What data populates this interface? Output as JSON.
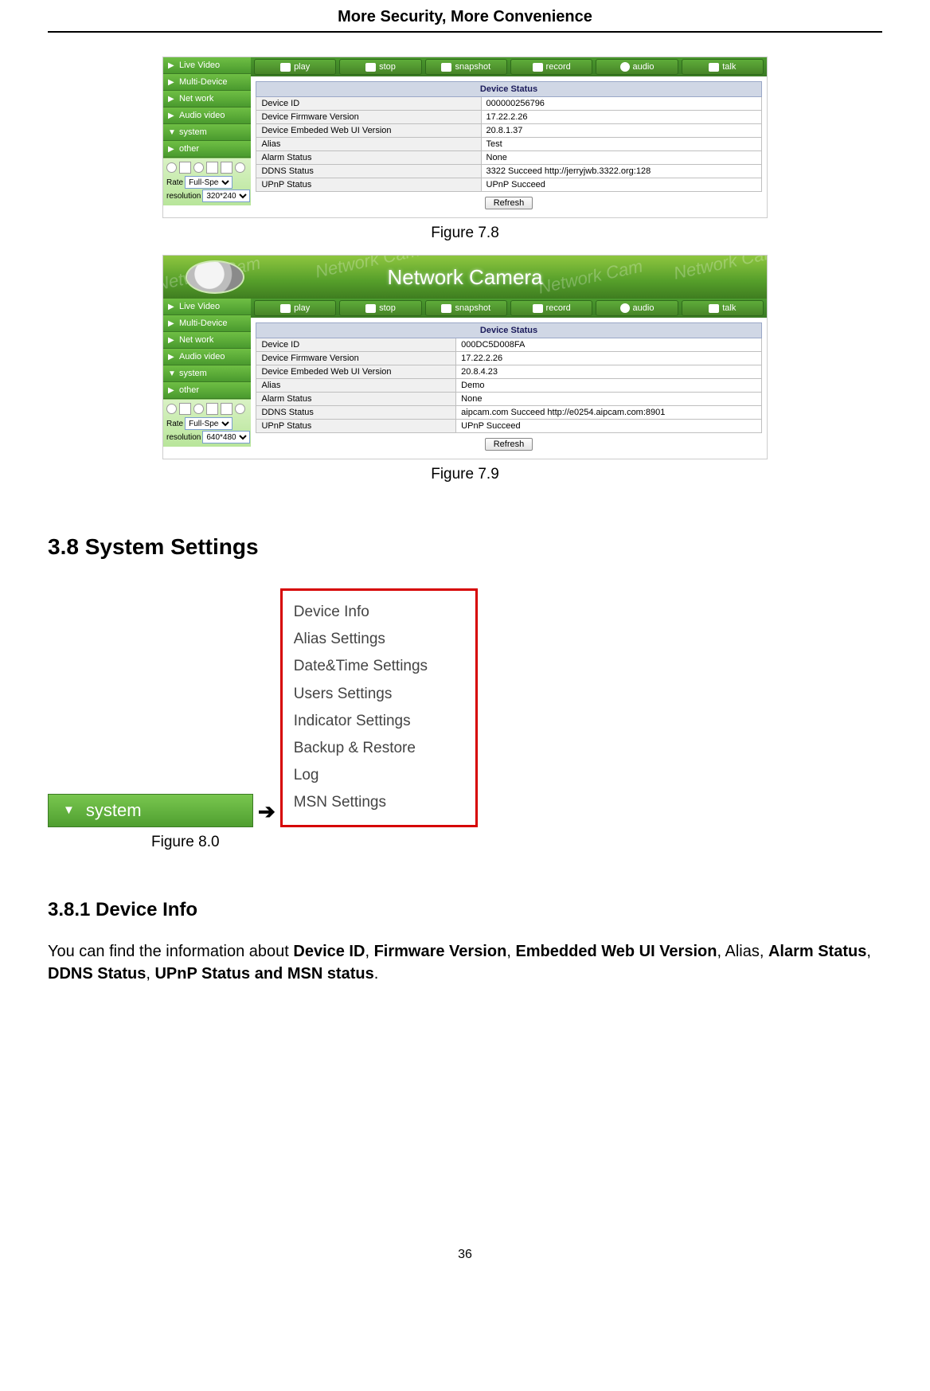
{
  "header": {
    "title": "More Security, More Convenience"
  },
  "fig78": {
    "sidebar": {
      "items": [
        {
          "label": "Live Video",
          "arrow": "▶"
        },
        {
          "label": "Multi-Device",
          "arrow": "▶"
        },
        {
          "label": "Net work",
          "arrow": "▶"
        },
        {
          "label": "Audio video",
          "arrow": "▶"
        },
        {
          "label": "system",
          "arrow": "▼"
        },
        {
          "label": "other",
          "arrow": "▶"
        }
      ],
      "rate_label": "Rate",
      "rate_value": "Full-Speed",
      "resolution_label": "resolution",
      "resolution_value": "320*240"
    },
    "toolbar": {
      "play": "play",
      "stop": "stop",
      "snapshot": "snapshot",
      "record": "record",
      "audio": "audio",
      "talk": "talk"
    },
    "status": {
      "title": "Device Status",
      "rows": [
        {
          "k": "Device ID",
          "v": "000000256796"
        },
        {
          "k": "Device Firmware Version",
          "v": "17.22.2.26"
        },
        {
          "k": "Device Embeded Web UI Version",
          "v": "20.8.1.37"
        },
        {
          "k": "Alias",
          "v": "Test"
        },
        {
          "k": "Alarm Status",
          "v": "None"
        },
        {
          "k": "DDNS Status",
          "v": "3322 Succeed  http://jerryjwb.3322.org:128"
        },
        {
          "k": "UPnP Status",
          "v": "UPnP Succeed"
        }
      ],
      "refresh": "Refresh"
    },
    "caption": "Figure 7.8"
  },
  "fig79": {
    "banner": {
      "title": "Network Camera",
      "watermark": "Network Cam"
    },
    "sidebar": {
      "items": [
        {
          "label": "Live Video",
          "arrow": "▶"
        },
        {
          "label": "Multi-Device",
          "arrow": "▶"
        },
        {
          "label": "Net work",
          "arrow": "▶"
        },
        {
          "label": "Audio video",
          "arrow": "▶"
        },
        {
          "label": "system",
          "arrow": "▼"
        },
        {
          "label": "other",
          "arrow": "▶"
        }
      ],
      "rate_label": "Rate",
      "rate_value": "Full-Speed",
      "resolution_label": "resolution",
      "resolution_value": "640*480"
    },
    "toolbar": {
      "play": "play",
      "stop": "stop",
      "snapshot": "snapshot",
      "record": "record",
      "audio": "audio",
      "talk": "talk"
    },
    "status": {
      "title": "Device Status",
      "rows": [
        {
          "k": "Device ID",
          "v": "000DC5D008FA"
        },
        {
          "k": "Device Firmware Version",
          "v": "17.22.2.26"
        },
        {
          "k": "Device Embeded Web UI Version",
          "v": "20.8.4.23"
        },
        {
          "k": "Alias",
          "v": "Demo"
        },
        {
          "k": "Alarm Status",
          "v": "None"
        },
        {
          "k": "DDNS Status",
          "v": "aipcam.com  Succeed  http://e0254.aipcam.com:8901"
        },
        {
          "k": "UPnP Status",
          "v": "UPnP Succeed"
        }
      ],
      "refresh": "Refresh"
    },
    "caption": "Figure 7.9"
  },
  "section": {
    "heading": "3.8 System Settings"
  },
  "fig80": {
    "system_arrow": "▼",
    "system_label": "system",
    "big_arrow": "➔",
    "menu_items": [
      "Device Info",
      "Alias Settings",
      "Date&Time Settings",
      "Users Settings",
      "Indicator Settings",
      "Backup & Restore",
      "Log",
      "MSN Settings"
    ],
    "caption": "Figure 8.0"
  },
  "subsection": {
    "heading": "3.8.1 Device Info"
  },
  "paragraph": {
    "pre": "You can find the information about ",
    "b1": "Device ID",
    "s1": ", ",
    "b2": "Firmware Version",
    "s2": ", ",
    "b3": "Embedded Web UI Version",
    "s3": ", Alias, ",
    "b4": "Alarm Status",
    "s4": ", ",
    "b5": "DDNS Status",
    "s5": ", ",
    "b6": "UPnP Status and MSN status",
    "post": "."
  },
  "page_number": "36"
}
